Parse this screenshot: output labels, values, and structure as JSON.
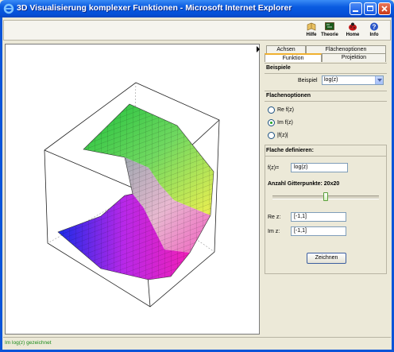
{
  "window": {
    "title": "3D Visualisierung komplexer Funktionen - Microsoft Internet Explorer"
  },
  "toolbar": {
    "buttons": [
      {
        "label": "Hilfe",
        "icon": "help-book-icon"
      },
      {
        "label": "Theorie",
        "icon": "theory-board-icon"
      },
      {
        "label": "Home",
        "icon": "home-ladybug-icon"
      },
      {
        "label": "Info",
        "icon": "info-icon"
      }
    ]
  },
  "tabs": {
    "row1": [
      "Achsen",
      "Flächenoptionen"
    ],
    "row2": [
      "Funktion",
      "Projektion"
    ],
    "active": "Funktion"
  },
  "beispiele": {
    "title": "Beispiele",
    "label": "Beispiel",
    "selected": "log(z)"
  },
  "flaechenoptionen": {
    "title": "Flachenoptionen",
    "options": [
      "Re f(z)",
      "Im f(z)",
      "|f(z)|"
    ],
    "checked": "Im f(z)"
  },
  "flaeche": {
    "title": "Flache definieren:",
    "fz_label": "f(z)=",
    "fz_value": "log(z)",
    "grid_label": "Anzahl Gitterpunkte: 20x20",
    "grid_fraction": 0.5,
    "re_label": "Re z:",
    "re_value": "[-1,1]",
    "im_label": "Im z:",
    "im_value": "[-1,1]",
    "button": "Zeichnen"
  },
  "status": {
    "text": "Im log(z) gezeichnet"
  },
  "colors": {
    "titlebar": "#0a5be0",
    "accent": "#f0b030",
    "status_text": "#1a8a1a"
  }
}
